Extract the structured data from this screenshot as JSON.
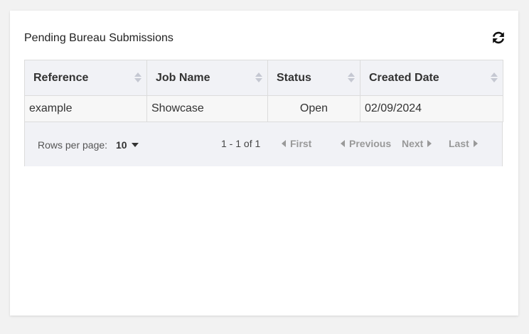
{
  "panel": {
    "title": "Pending Bureau Submissions",
    "refresh_icon": "refresh-icon"
  },
  "table": {
    "columns": [
      {
        "label": "Reference"
      },
      {
        "label": "Job Name"
      },
      {
        "label": "Status"
      },
      {
        "label": "Created Date"
      }
    ],
    "rows": [
      {
        "reference": "example",
        "job_name": "Showcase",
        "status": "Open",
        "created_date": "02/09/2024"
      }
    ]
  },
  "pagination": {
    "rows_per_page_label": "Rows per page:",
    "rows_per_page_value": "10",
    "range_text": "1 - 1 of 1",
    "first_label": "First",
    "previous_label": "Previous",
    "next_label": "Next",
    "last_label": "Last"
  },
  "colors": {
    "header_bg": "#f1f2f6",
    "row_bg": "#f7f7f7",
    "border": "#dcdcdc",
    "disabled_nav": "#999999"
  }
}
